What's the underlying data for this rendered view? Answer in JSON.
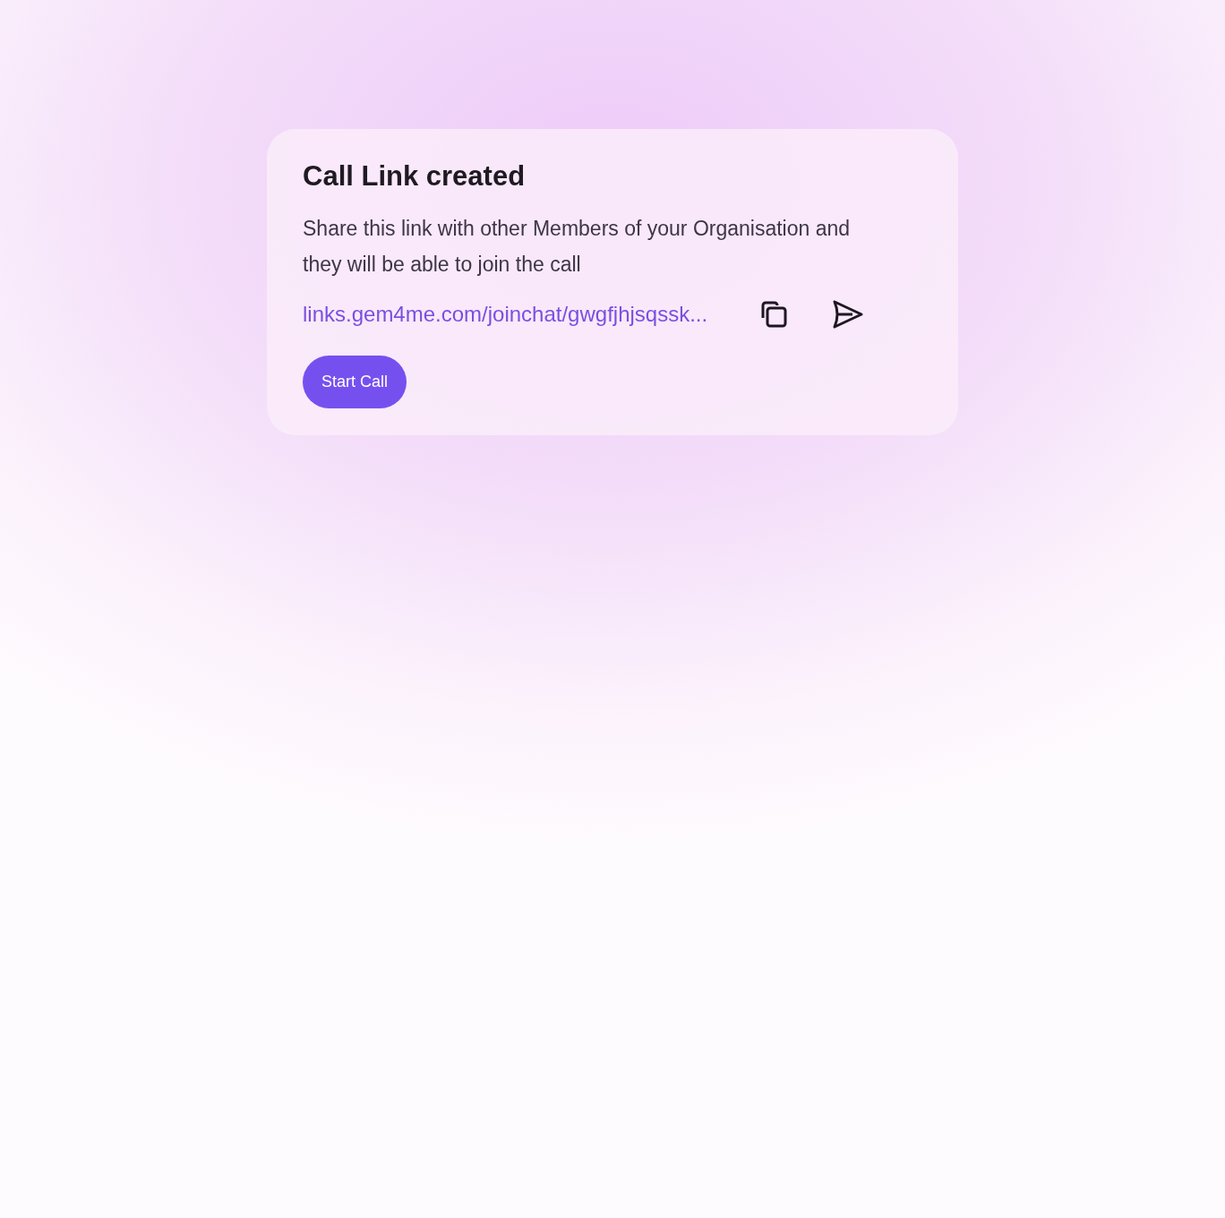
{
  "dialog": {
    "title": "Call Link created",
    "message": "Share this link with other Members of your Organisation and they will be able to join the call",
    "link": "links.gem4me.com/joinchat/gwgfjhjsqssk...",
    "buttons": [
      "Start Call"
    ]
  }
}
